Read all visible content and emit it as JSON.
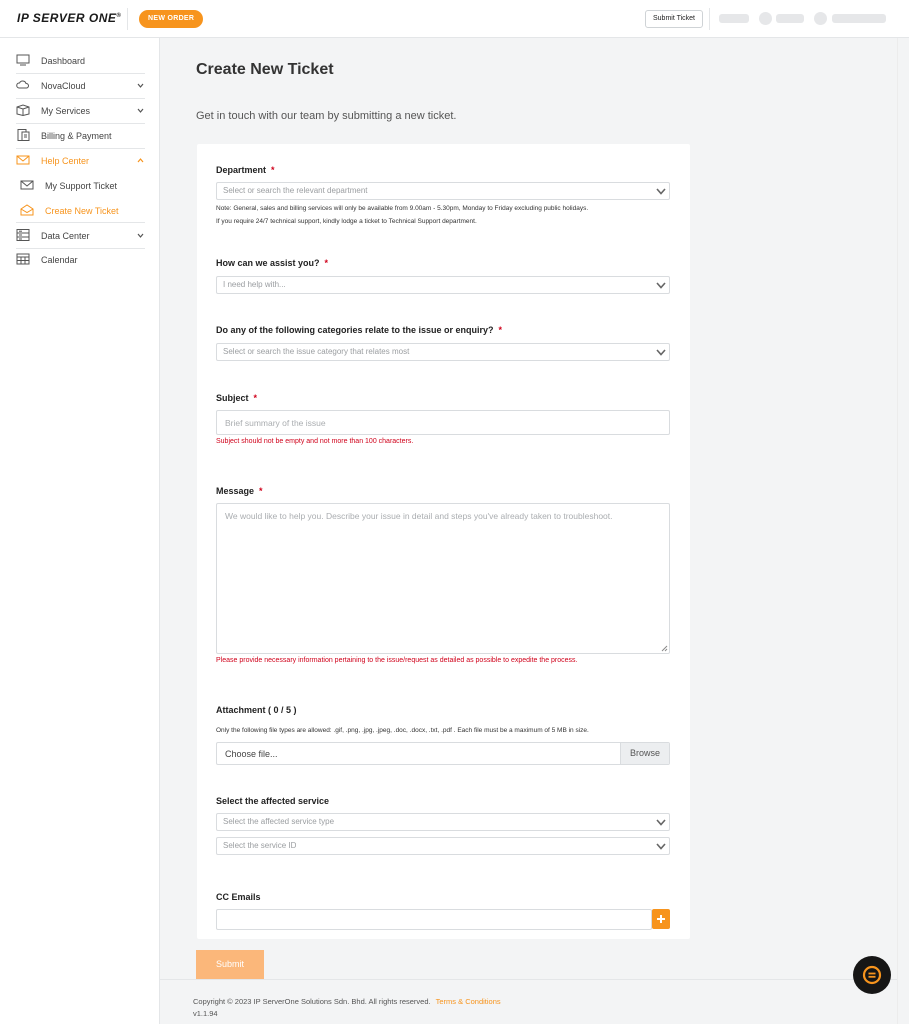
{
  "header": {
    "logo": "IP SERVER ONE",
    "new_order": "NEW ORDER",
    "submit_ticket": "Submit Ticket"
  },
  "sidebar": {
    "items": [
      {
        "label": "Dashboard",
        "icon": "monitor-icon"
      },
      {
        "label": "NovaCloud",
        "icon": "cloud-icon"
      },
      {
        "label": "My Services",
        "icon": "box-icon"
      },
      {
        "label": "Billing & Payment",
        "icon": "invoice-icon"
      },
      {
        "label": "Help Center",
        "icon": "envelope-icon"
      },
      {
        "label": "My Support Ticket",
        "icon": "envelope-icon"
      },
      {
        "label": "Create New Ticket",
        "icon": "envelope-open-icon"
      },
      {
        "label": "Data Center",
        "icon": "server-icon"
      },
      {
        "label": "Calendar",
        "icon": "calendar-icon"
      }
    ]
  },
  "page": {
    "title": "Create New Ticket",
    "subtitle": "Get in touch with our team by submitting a new ticket."
  },
  "form": {
    "department": {
      "label": "Department",
      "placeholder": "Select or search the relevant department",
      "note1": "Note: General, sales and billing services will only be available from 9.00am - 5.30pm, Monday to Friday excluding public holidays.",
      "note2": "If you require 24/7 technical support, kindly lodge a ticket to Technical Support department."
    },
    "assist": {
      "label": "How can we assist you?",
      "placeholder": "I need help with..."
    },
    "category": {
      "label": "Do any of the following categories relate to the issue or enquiry?",
      "placeholder": "Select or search the issue category that relates most"
    },
    "subject": {
      "label": "Subject",
      "placeholder": "Brief summary of the issue",
      "error": "Subject should not be empty and not more than 100 characters."
    },
    "message": {
      "label": "Message",
      "placeholder": "We would like to help you. Describe your issue in detail and steps you've already taken to troubleshoot.",
      "error": "Please provide necessary information pertaining to the issue/request as detailed as possible to expedite the process."
    },
    "attachment": {
      "label": "Attachment ( 0 / 5 )",
      "note": "Only the following file types are allowed: .gif, .png, .jpg, .jpeg, .doc, .docx, .txt, .pdf . Each file must be a maximum of 5 MB in size.",
      "choose": "Choose file...",
      "browse": "Browse"
    },
    "service": {
      "label": "Select the affected service",
      "type_placeholder": "Select the affected service type",
      "id_placeholder": "Select the service ID"
    },
    "cc": {
      "label": "CC Emails"
    },
    "submit": "Submit"
  },
  "footer": {
    "copyright": "Copyright © 2023 IP ServerOne Solutions Sdn. Bhd. All rights reserved.",
    "terms": "Terms & Conditions",
    "version": "v1.1.94"
  },
  "colors": {
    "accent": "#f7941d",
    "error": "#d0021b"
  }
}
